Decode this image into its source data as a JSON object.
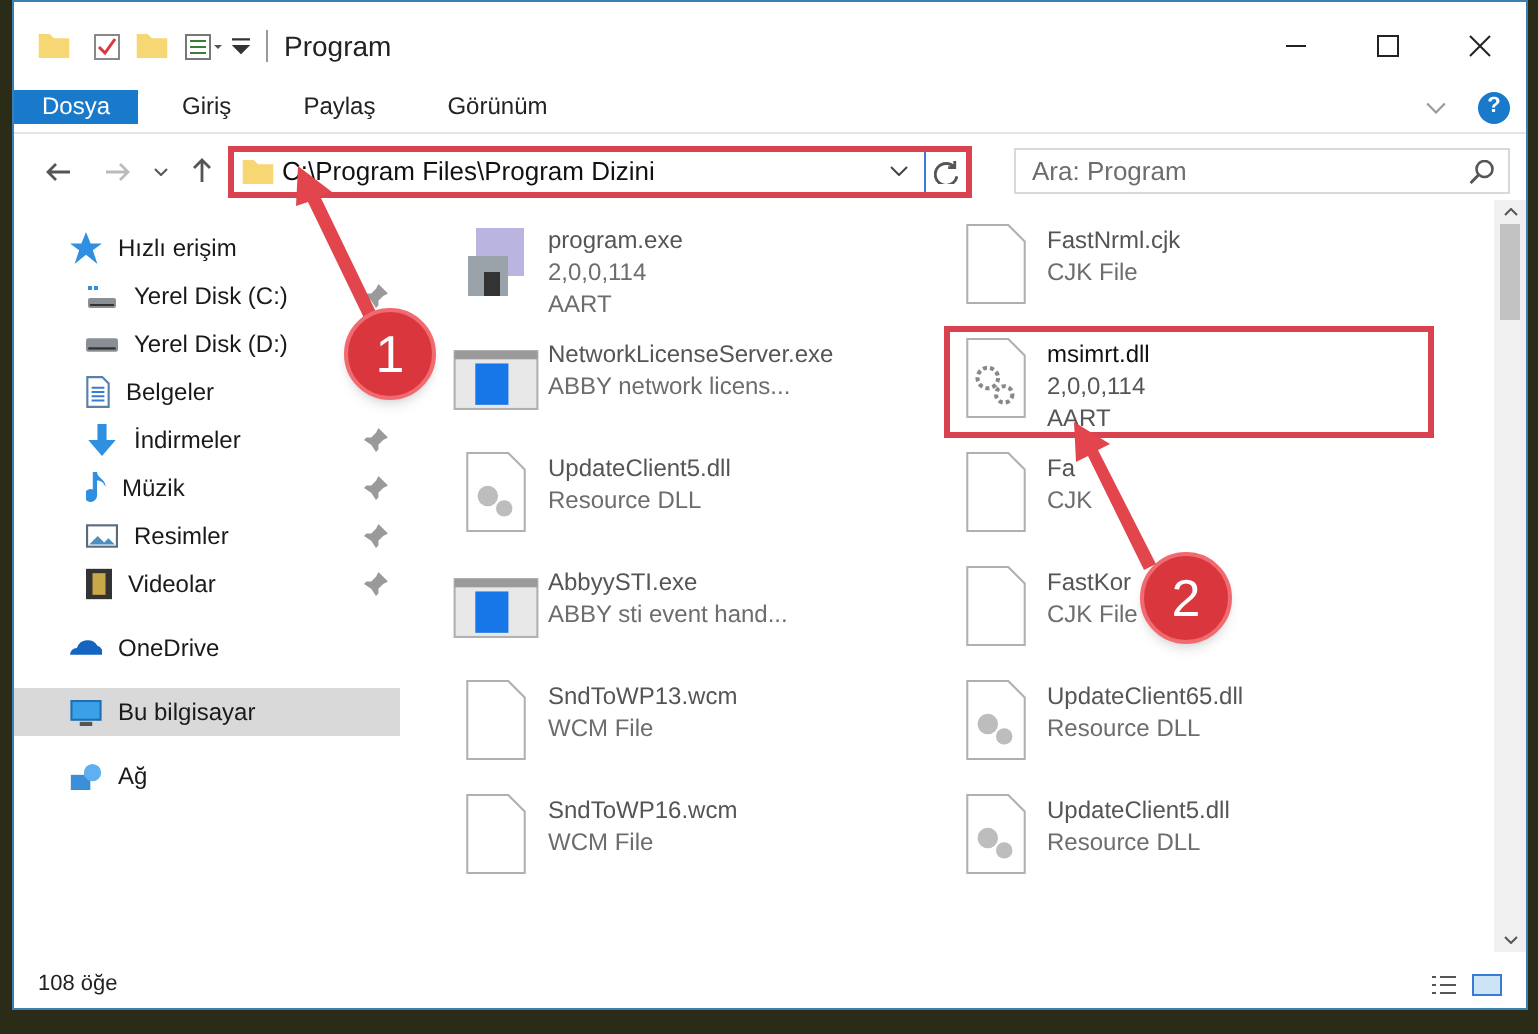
{
  "window": {
    "title": "Program"
  },
  "ribbon_tabs": [
    {
      "label": "Dosya",
      "selected": true
    },
    {
      "label": "Giriş",
      "selected": false
    },
    {
      "label": "Paylaş",
      "selected": false
    },
    {
      "label": "Görünüm",
      "selected": false
    }
  ],
  "help": "?",
  "address": {
    "path": "C:\\Program Files\\Program Dizini",
    "highlighted": true
  },
  "search": {
    "placeholder": "Ara: Program"
  },
  "sidebar": {
    "items": [
      {
        "label": "Hızlı erişim",
        "selected": false,
        "children": [
          {
            "label": "Yerel Disk (C:)",
            "pinned": true,
            "selected": false
          },
          {
            "label": "Yerel Disk (D:)",
            "pinned": false,
            "selected": false
          },
          {
            "label": "Belgeler",
            "pinned": false,
            "selected": false
          },
          {
            "label": "İndirmeler",
            "pinned": true,
            "selected": false
          },
          {
            "label": "Müzik",
            "pinned": true,
            "selected": false
          },
          {
            "label": "Resimler",
            "pinned": true,
            "selected": false
          },
          {
            "label": "Videolar",
            "pinned": true,
            "selected": false
          }
        ]
      },
      {
        "label": "OneDrive",
        "selected": false
      },
      {
        "label": "Bu bilgisayar",
        "selected": true
      },
      {
        "label": "Ağ",
        "selected": false
      }
    ]
  },
  "files": [
    {
      "name": "program.exe",
      "details": [
        "2,0,0,114",
        "AART"
      ],
      "kind": "installer",
      "highlighted": false
    },
    {
      "name": "FastNrml.cjk",
      "details": [
        "CJK File"
      ],
      "kind": "document",
      "highlighted": false
    },
    {
      "name": "NetworkLicenseServer.exe",
      "details": [
        "ABBY network licens..."
      ],
      "kind": "app",
      "highlighted": false
    },
    {
      "name": "msimrt.dll",
      "details": [
        "2,0,0,114",
        "AART"
      ],
      "kind": "library",
      "highlighted": true
    },
    {
      "name": "UpdateClient5.dll",
      "details": [
        "Resource DLL"
      ],
      "kind": "resource",
      "highlighted": false
    },
    {
      "name": "Fa",
      "details": [
        "CJK"
      ],
      "kind": "document",
      "highlighted": false
    },
    {
      "name": "AbbyySTI.exe",
      "details": [
        "ABBY sti event hand..."
      ],
      "kind": "app",
      "highlighted": false
    },
    {
      "name": "FastKor",
      "details": [
        "CJK File"
      ],
      "kind": "document",
      "highlighted": false
    },
    {
      "name": "SndToWP13.wcm",
      "details": [
        "WCM File"
      ],
      "kind": "document",
      "highlighted": false
    },
    {
      "name": "UpdateClient65.dll",
      "details": [
        "Resource DLL"
      ],
      "kind": "resource",
      "highlighted": false
    },
    {
      "name": "SndToWP16.wcm",
      "details": [
        "WCM File"
      ],
      "kind": "document",
      "highlighted": false
    },
    {
      "name": "UpdateClient5.dll",
      "details": [
        "Resource DLL"
      ],
      "kind": "resource",
      "highlighted": false
    }
  ],
  "status_bar": {
    "count": "108 öğe"
  },
  "annotations": [
    {
      "kind": "callout",
      "label": "1"
    },
    {
      "kind": "callout",
      "label": "2"
    }
  ]
}
